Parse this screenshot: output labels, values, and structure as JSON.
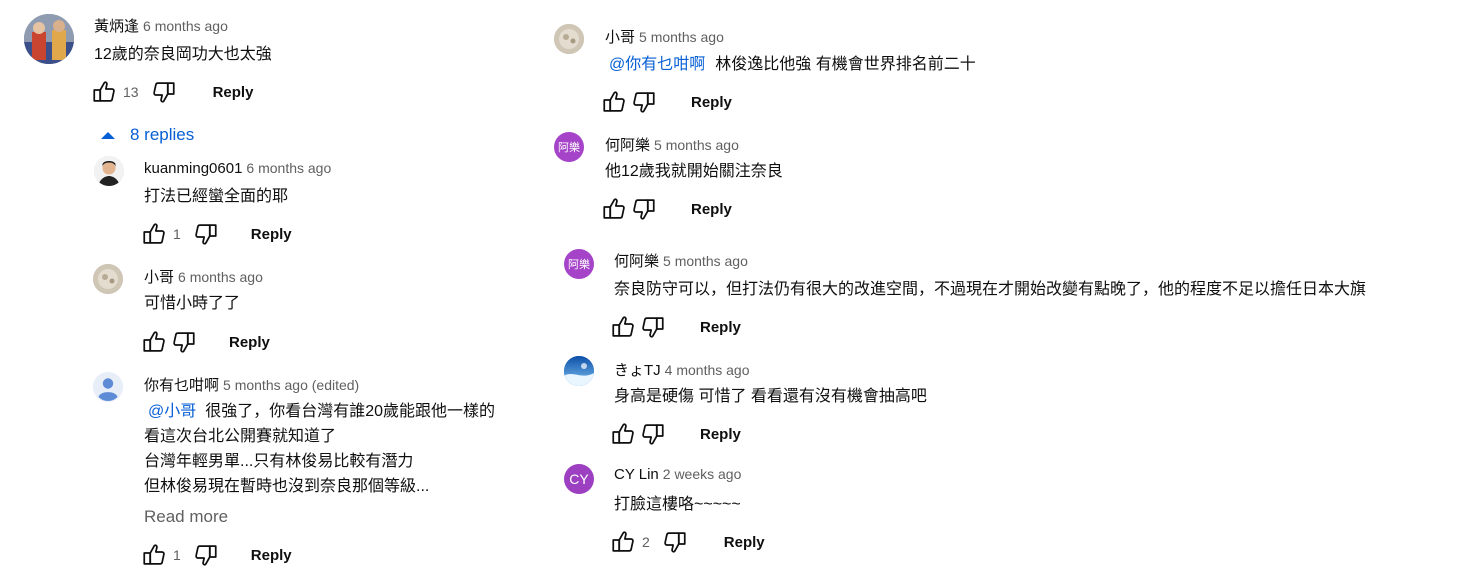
{
  "left": {
    "top_comment": {
      "author": "黃炳逢",
      "time": "6 months ago",
      "text": "12歲的奈良岡功大也太強",
      "likes": "13",
      "reply_label": "Reply"
    },
    "replies_toggle": "8 replies",
    "replies": [
      {
        "author": "kuanming0601",
        "time": "6 months ago",
        "text": "打法已經蠻全面的耶",
        "likes": "1",
        "reply_label": "Reply"
      },
      {
        "author": "小哥",
        "time": "6 months ago",
        "text": "可惜小時了了",
        "likes": "",
        "reply_label": "Reply"
      },
      {
        "author": "你有乜咁啊",
        "time": "5 months ago (edited)",
        "mention": "@小哥",
        "lines": [
          "很強了，你看台灣有誰20歲能跟他一樣的",
          "看這次台北公開賽就知道了",
          "台灣年輕男單...只有林俊易比較有潛力",
          "但林俊易現在暫時也沒到奈良那個等級..."
        ],
        "read_more": "Read more",
        "likes": "1",
        "reply_label": "Reply"
      }
    ]
  },
  "right": {
    "replies": [
      {
        "author": "小哥",
        "time": "5 months ago",
        "mention": "@你有乜咁啊",
        "text": "林俊逸比他強 有機會世界排名前二十",
        "likes": "",
        "reply_label": "Reply"
      },
      {
        "author": "何阿樂",
        "avatar_text": "阿樂",
        "time": "5 months ago",
        "text": "他12歲我就開始關注奈良",
        "likes": "",
        "reply_label": "Reply"
      },
      {
        "author": "何阿樂",
        "avatar_text": "阿樂",
        "time": "5 months ago",
        "text": "奈良防守可以，但打法仍有很大的改進空間，不過現在才開始改變有點晚了，他的程度不足以擔任日本大旗",
        "likes": "",
        "reply_label": "Reply"
      },
      {
        "author": "きょTJ",
        "time": "4 months ago",
        "text": "身高是硬傷 可惜了 看看還有沒有機會抽高吧",
        "likes": "",
        "reply_label": "Reply"
      },
      {
        "author": "CY Lin",
        "avatar_text": "CY",
        "time": "2 weeks ago",
        "text": "打臉這樓咯~~~~~",
        "likes": "2",
        "reply_label": "Reply"
      }
    ]
  },
  "colors": {
    "link": "#065fd4",
    "secondary": "#606060",
    "avatar_purple": "#a544c8",
    "avatar_cy": "#9c3fc1"
  }
}
